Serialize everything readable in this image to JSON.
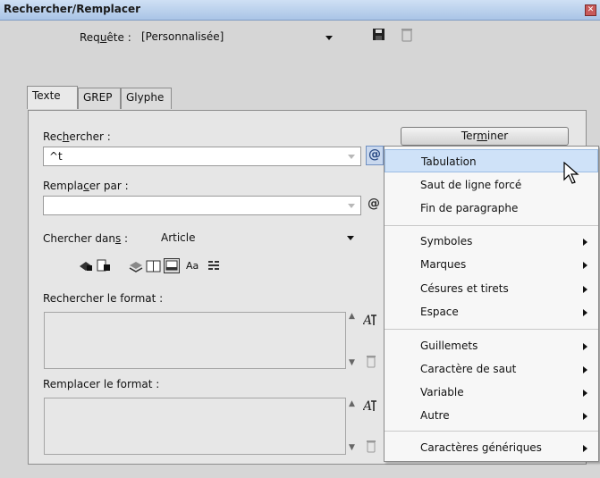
{
  "window": {
    "title": "Rechercher/Remplacer"
  },
  "query": {
    "label_pre": "Req",
    "label_u": "u",
    "label_post": "ête :",
    "value": "[Personnalisée]"
  },
  "tabs": [
    {
      "label": "Texte"
    },
    {
      "label": "GREP"
    },
    {
      "label": "Glyphe"
    }
  ],
  "find": {
    "label_pre": "Rec",
    "label_u": "h",
    "label_post": "ercher :",
    "value": "^t"
  },
  "replace": {
    "label_pre": "Rempla",
    "label_u": "c",
    "label_post": "er par :",
    "value": ""
  },
  "search_in": {
    "label_pre": "Chercher dan",
    "label_u": "s",
    "label_post": " :",
    "value": "Article"
  },
  "option_case_label": "Aa",
  "find_format": {
    "label": "Rechercher le format :"
  },
  "replace_format": {
    "label": "Remplacer le format :"
  },
  "done_button": {
    "label_pre": "Ter",
    "label_u": "m",
    "label_post": "iner"
  },
  "special_menu": {
    "items": [
      {
        "label": "Tabulation",
        "highlighted": true,
        "submenu": false
      },
      {
        "label": "Saut de ligne forcé",
        "submenu": false
      },
      {
        "label": "Fin de paragraphe",
        "submenu": false
      },
      {
        "label": "Symboles",
        "submenu": true
      },
      {
        "label": "Marques",
        "submenu": true
      },
      {
        "label": "Césures et tirets",
        "submenu": true
      },
      {
        "label": "Espace",
        "submenu": true
      },
      {
        "label": "Guillemets",
        "submenu": true
      },
      {
        "label": "Caractère de saut",
        "submenu": true
      },
      {
        "label": "Variable",
        "submenu": true
      },
      {
        "label": "Autre",
        "submenu": true
      },
      {
        "label": "Caractères génériques",
        "submenu": true
      }
    ]
  },
  "icons": [
    "save-query-icon",
    "delete-query-icon",
    "special-chars-icon",
    "arrow-cursor-icon"
  ]
}
